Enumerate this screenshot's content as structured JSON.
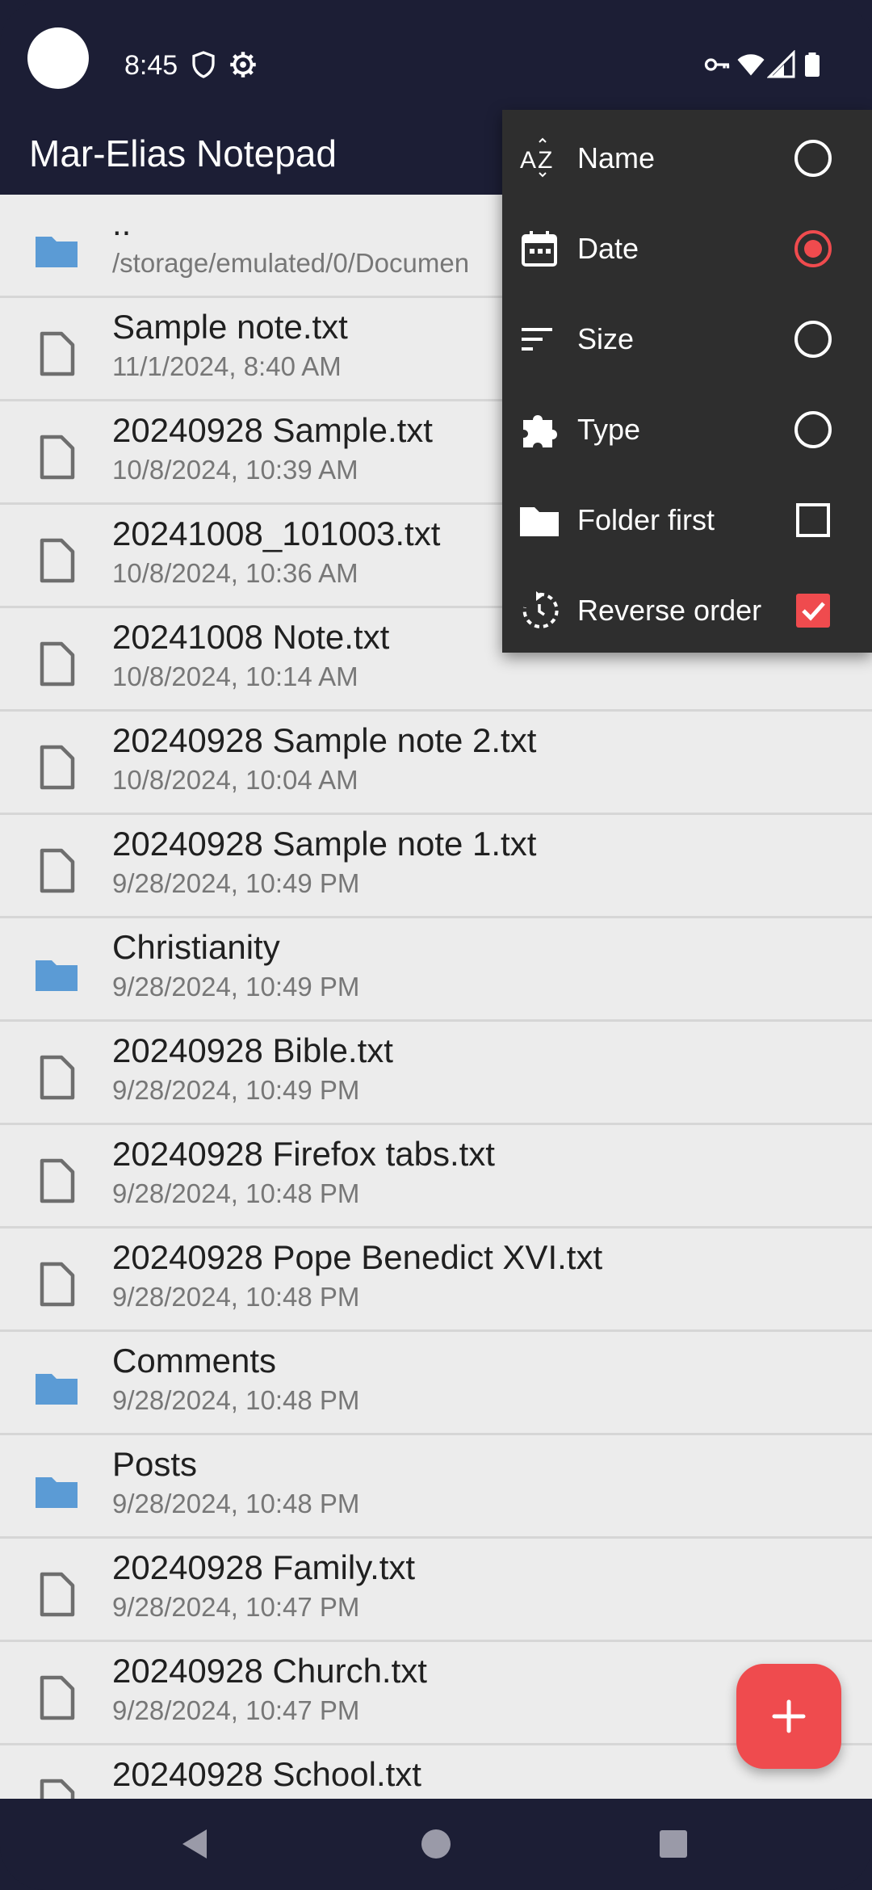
{
  "status_bar": {
    "time": "8:45",
    "icons": [
      "shield-icon",
      "settings-gear-icon",
      "vpn-key-icon",
      "wifi-icon",
      "signal-icon",
      "battery-icon"
    ]
  },
  "app_bar": {
    "title": "Mar-Elias Notepad"
  },
  "files": [
    {
      "type": "folder",
      "name": "..",
      "sub": "/storage/emulated/0/Documen"
    },
    {
      "type": "file",
      "name": "Sample note.txt",
      "sub": "11/1/2024, 8:40 AM"
    },
    {
      "type": "file",
      "name": "20240928 Sample.txt",
      "sub": "10/8/2024, 10:39 AM"
    },
    {
      "type": "file",
      "name": "20241008_101003.txt",
      "sub": "10/8/2024, 10:36 AM"
    },
    {
      "type": "file",
      "name": "20241008 Note.txt",
      "sub": "10/8/2024, 10:14 AM"
    },
    {
      "type": "file",
      "name": "20240928 Sample note 2.txt",
      "sub": "10/8/2024, 10:04 AM"
    },
    {
      "type": "file",
      "name": "20240928 Sample note 1.txt",
      "sub": "9/28/2024, 10:49 PM"
    },
    {
      "type": "folder",
      "name": "Christianity",
      "sub": "9/28/2024, 10:49 PM"
    },
    {
      "type": "file",
      "name": "20240928 Bible.txt",
      "sub": "9/28/2024, 10:49 PM"
    },
    {
      "type": "file",
      "name": "20240928 Firefox tabs.txt",
      "sub": "9/28/2024, 10:48 PM"
    },
    {
      "type": "file",
      "name": "20240928 Pope Benedict XVI.txt",
      "sub": "9/28/2024, 10:48 PM"
    },
    {
      "type": "folder",
      "name": "Comments",
      "sub": "9/28/2024, 10:48 PM"
    },
    {
      "type": "folder",
      "name": "Posts",
      "sub": "9/28/2024, 10:48 PM"
    },
    {
      "type": "file",
      "name": "20240928 Family.txt",
      "sub": "9/28/2024, 10:47 PM"
    },
    {
      "type": "file",
      "name": "20240928 Church.txt",
      "sub": "9/28/2024, 10:47 PM"
    },
    {
      "type": "file",
      "name": "20240928 School.txt",
      "sub": ""
    }
  ],
  "sort_menu": {
    "items": [
      {
        "label": "Name",
        "icon": "sort-alpha-icon",
        "control": "radio",
        "checked": false
      },
      {
        "label": "Date",
        "icon": "calendar-icon",
        "control": "radio",
        "checked": true
      },
      {
        "label": "Size",
        "icon": "sort-lines-icon",
        "control": "radio",
        "checked": false
      },
      {
        "label": "Type",
        "icon": "puzzle-icon",
        "control": "radio",
        "checked": false
      },
      {
        "label": "Folder first",
        "icon": "folder-icon",
        "control": "checkbox",
        "checked": false
      },
      {
        "label": "Reverse order",
        "icon": "reverse-rotate-icon",
        "control": "checkbox",
        "checked": true
      }
    ]
  },
  "fab": {
    "icon": "plus-icon"
  },
  "nav_bar": {
    "buttons": [
      "back-icon",
      "home-icon",
      "recents-icon"
    ]
  },
  "colors": {
    "accent": "#ef4b4e",
    "folder": "#5b9bd5",
    "bar_background": "#1c1e35",
    "list_background": "#ececec",
    "menu_background": "#2e2e2e"
  }
}
